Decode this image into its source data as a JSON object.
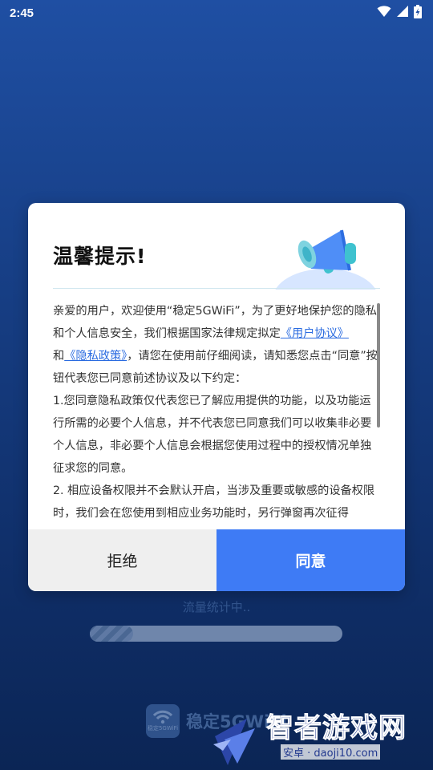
{
  "status_bar": {
    "time": "2:45",
    "icons": [
      "wifi-icon",
      "cellular-icon",
      "battery-icon"
    ]
  },
  "background": {
    "status_text": "流量统计中..",
    "progress_fraction": 0.17,
    "app_name": "稳定5GWiFi",
    "app_logo_caption": "稳定5GWiFi"
  },
  "dialog": {
    "title": "温馨提示!",
    "paragraph1": {
      "text_before_link1": "亲爱的用户，欢迎使用“稳定5GWiFi”，为了更好地保护您的隐私和个人信息安全，我们根据国家法律规定拟定",
      "link1": "《用户协议》",
      "text_between": "和",
      "link2": "《隐私政策》",
      "text_after_link2": "，请您在使用前仔细阅读，请知悉您点击“同意”按钮代表您已同意前述协议及以下约定："
    },
    "item1": "1.您同意隐私政策仅代表您已了解应用提供的功能，以及功能运行所需的必要个人信息，并不代表您已同意我们可以收集非必要个人信息，非必要个人信息会根据您使用过程中的授权情况单独征求您的同意。",
    "item2": "2. 相应设备权限并不会默认开启，当涉及重要或敏感的设备权限时，我们会在您使用到相应业务功能时，另行弹窗再次征得",
    "reject_label": "拒绝",
    "agree_label": "同意"
  },
  "watermark": {
    "title": "智者游戏网",
    "subtitle": "安卓 · daoji10.com"
  },
  "colors": {
    "accent": "#3e7bf5",
    "link": "#2a6be0",
    "background_top": "#1f4fa3",
    "background_bottom": "#0b2555"
  }
}
